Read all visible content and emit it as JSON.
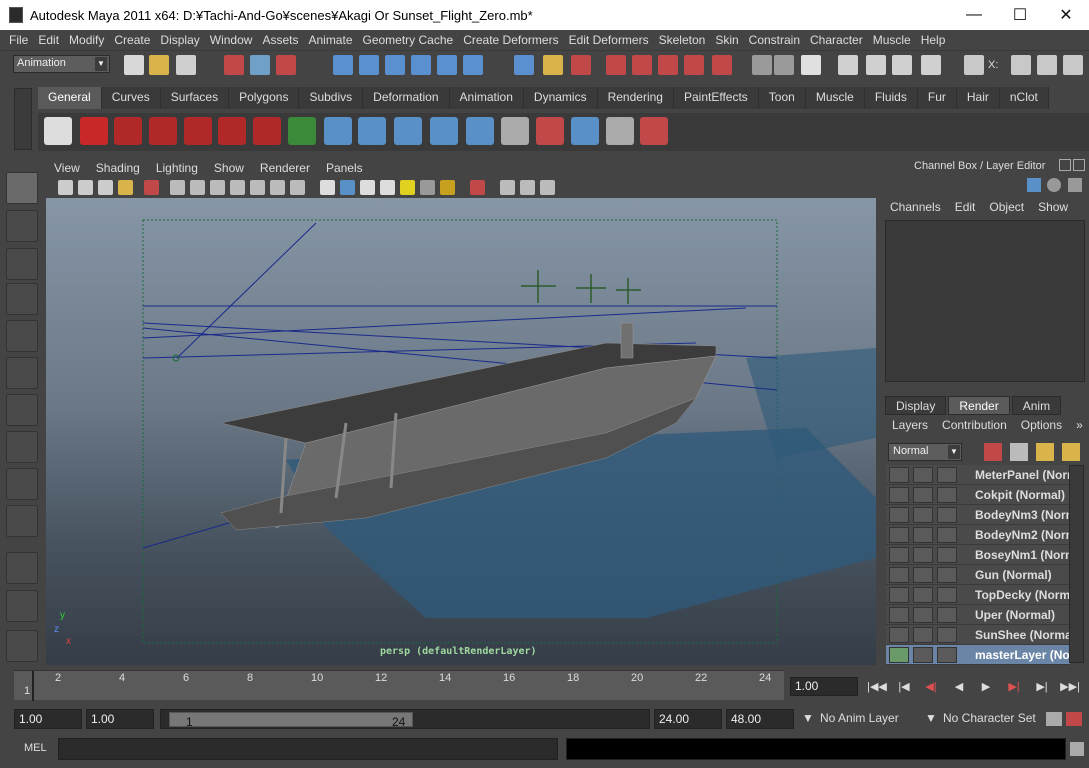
{
  "window": {
    "title": "Autodesk Maya 2011 x64: D:¥Tachi-And-Go¥scenes¥Akagi Or Sunset_Flight_Zero.mb*",
    "minimize": "—",
    "maximize": "☐",
    "close": "✕"
  },
  "menubar": [
    "File",
    "Edit",
    "Modify",
    "Create",
    "Display",
    "Window",
    "Assets",
    "Animate",
    "Geometry Cache",
    "Create Deformers",
    "Edit Deformers",
    "Skeleton",
    "Skin",
    "Constrain",
    "Character",
    "Muscle",
    "Help"
  ],
  "statusline": {
    "mode": "Animation",
    "x_label": "X:"
  },
  "shelf": {
    "tabs": [
      "General",
      "Curves",
      "Surfaces",
      "Polygons",
      "Subdivs",
      "Deformation",
      "Animation",
      "Dynamics",
      "Rendering",
      "PaintEffects",
      "Toon",
      "Muscle",
      "Fluids",
      "Fur",
      "Hair",
      "nClot"
    ],
    "active_tab": "General"
  },
  "panel": {
    "menus": [
      "View",
      "Shading",
      "Lighting",
      "Show",
      "Renderer",
      "Panels"
    ],
    "camera_label": "persp (defaultRenderLayer)",
    "axis_y": "y",
    "axis_z": "z",
    "axis_x": "x"
  },
  "channel_box": {
    "title": "Channel Box / Layer Editor",
    "menus": [
      "Channels",
      "Edit",
      "Object",
      "Show"
    ]
  },
  "layer_editor": {
    "tabs": [
      "Display",
      "Render",
      "Anim"
    ],
    "active_tab": "Render",
    "menus": [
      "Layers",
      "Contribution",
      "Options"
    ],
    "blend_mode": "Normal",
    "layers": [
      {
        "name": "MeterPanel (Norm"
      },
      {
        "name": "Cokpit (Normal)"
      },
      {
        "name": "BodeyNm3 (Norm"
      },
      {
        "name": "BodeyNm2 (Norm"
      },
      {
        "name": "BoseyNm1 (Norm"
      },
      {
        "name": "Gun (Normal)"
      },
      {
        "name": "TopDecky (Norm"
      },
      {
        "name": "Uper (Normal)"
      },
      {
        "name": "SunShee (Norma"
      },
      {
        "name": "masterLayer (No",
        "selected": true
      }
    ]
  },
  "timeline": {
    "ticks": [
      "1",
      "2",
      "4",
      "6",
      "8",
      "10",
      "12",
      "14",
      "16",
      "18",
      "20",
      "22",
      "24"
    ],
    "current_frame": "1.00"
  },
  "playback": [
    "|◀◀",
    "|◀",
    "◀|",
    "◀",
    "▶",
    "▶|",
    "▶|",
    "▶▶|"
  ],
  "range": {
    "anim_start": "1.00",
    "playback_start": "1.00",
    "range_start_label": "1",
    "range_end_label": "24",
    "playback_end": "24.00",
    "anim_end": "48.00",
    "anim_layer": "No Anim Layer",
    "character_set": "No Character Set"
  },
  "command_line": {
    "label": "MEL"
  }
}
